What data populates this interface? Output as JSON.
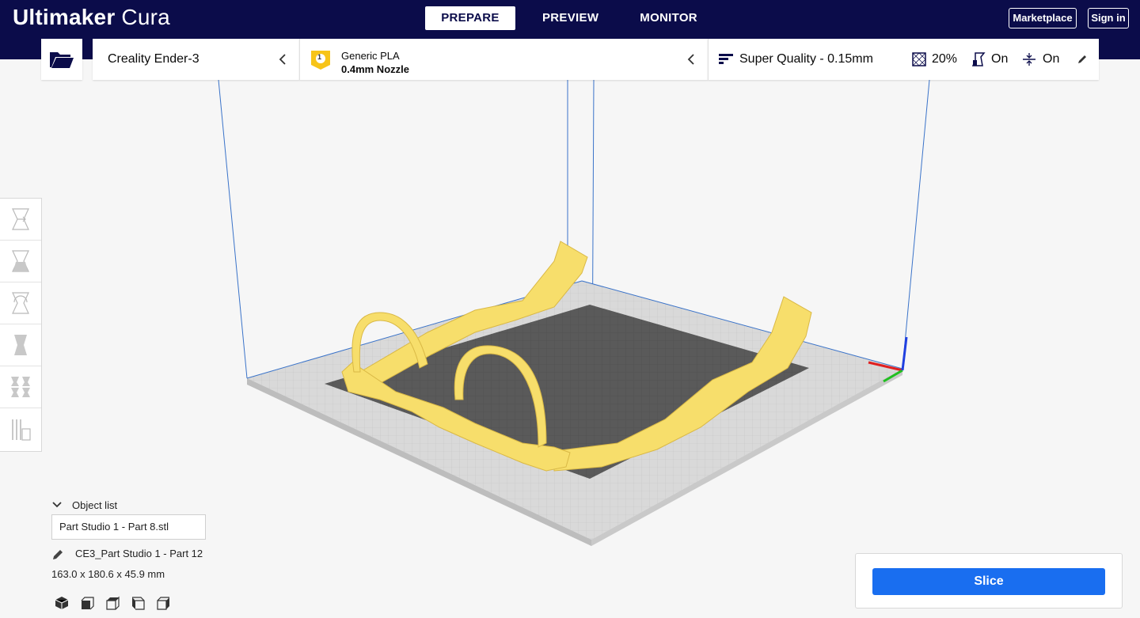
{
  "app": {
    "logo_bold": "Ultimaker",
    "logo_light": " Cura"
  },
  "nav": {
    "tabs": [
      {
        "label": "PREPARE",
        "active": true
      },
      {
        "label": "PREVIEW"
      },
      {
        "label": "MONITOR"
      }
    ]
  },
  "header_buttons": {
    "marketplace": "Marketplace",
    "signin": "Sign in"
  },
  "printer": {
    "name": "Creality Ender-3"
  },
  "material": {
    "badge": "1",
    "name": "Generic PLA",
    "nozzle": "0.4mm Nozzle"
  },
  "print_settings": {
    "quality": "Super Quality - 0.15mm",
    "infill": "20%",
    "support": "On",
    "adhesion": "On"
  },
  "object_list": {
    "header": "Object list",
    "items": [
      "Part Studio 1 - Part 8.stl"
    ],
    "current_name": "CE3_Part Studio 1 - Part 12",
    "dimensions": "163.0 x 180.6 x 45.9 mm"
  },
  "slice": {
    "label": "Slice"
  },
  "colors": {
    "header": "#0b0c4a",
    "accent": "#196ef0",
    "model": "#f7de6b",
    "build_plate": "#5a5a5a"
  },
  "icons": [
    "folder-open-icon",
    "chevron-left-icon",
    "material-badge-icon",
    "quality-icon",
    "infill-icon",
    "support-icon",
    "adhesion-icon",
    "pencil-icon",
    "move-tool-icon",
    "scale-tool-icon",
    "rotate-tool-icon",
    "mirror-tool-icon",
    "per-model-settings-icon",
    "support-blocker-icon",
    "chevron-down-icon",
    "3d-view-icon",
    "front-view-icon",
    "top-view-icon",
    "left-view-icon",
    "right-view-icon"
  ]
}
